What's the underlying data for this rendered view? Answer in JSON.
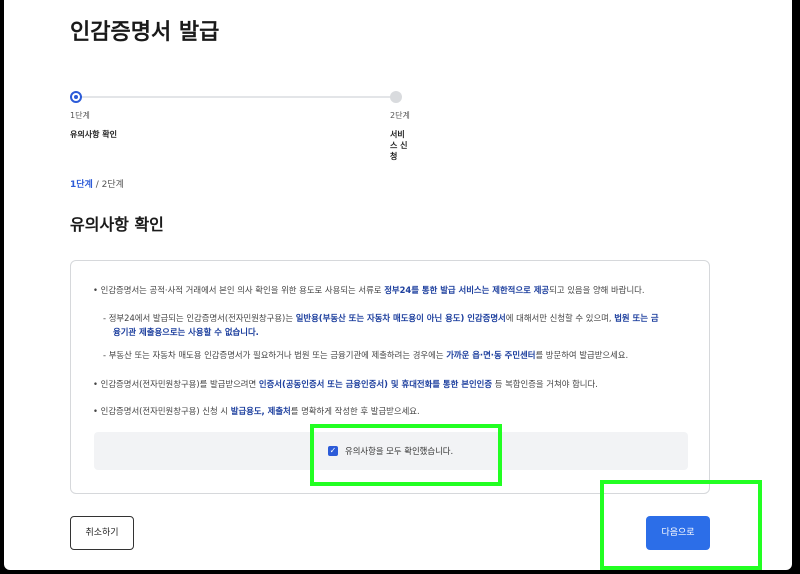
{
  "page": {
    "title": "인감증명서 발급"
  },
  "stepper": {
    "steps": [
      {
        "num": "1단계",
        "name": "유의사항 확인",
        "state": "active"
      },
      {
        "num": "2단계",
        "name": "서비스 신청",
        "state": "inactive"
      }
    ]
  },
  "breadcrumb": {
    "current": "1단계",
    "separator": " / ",
    "total": "2단계"
  },
  "section": {
    "title": "유의사항 확인"
  },
  "notice": {
    "items": [
      {
        "bullet": "•",
        "before": "인감증명서는 공적·사적 거래에서 본인 의사 확인을 위한 용도로 사용되는 서류로 ",
        "highlight": "정부24를 통한 발급 서비스는 제한적으로 제공",
        "after": "되고 있음을 양해 바랍니다."
      },
      {
        "dash": "-",
        "before": "정부24에서 발급되는 인감증명서(전자민원창구용)는 ",
        "highlight1": "일반용(부동산 또는 자동차 매도용이 아닌 용도) 인감증명서",
        "middle": "에 대해서만 신청할 수 있으며, ",
        "highlight2": "법원 또는 금",
        "line2": "융기관 제출용으로는 사용할 수 없습니다."
      },
      {
        "dash": "-",
        "before": "부동산 또는 자동차 매도용 인감증명서가 필요하거나 법원 또는 금융기관에 제출하려는 경우에는 ",
        "highlight": "가까운 읍·면·동 주민센터",
        "after": "를 방문하여 발급받으세요."
      },
      {
        "bullet": "•",
        "before": "인감증명서(전자민원창구용)를 발급받으려면 ",
        "highlight": "인증서(공동인증서 또는 금융인증서) 및 휴대전화를 통한 본인인증",
        "after": " 등 복합인증을 거쳐야 합니다."
      },
      {
        "bullet": "•",
        "before": "인감증명서(전자민원창구용) 신청 시 ",
        "highlight": "발급용도, 제출처",
        "after": "를 명확하게 작성한 후 발급받으세요."
      }
    ]
  },
  "confirm": {
    "label": "유의사항을 모두 확인했습니다.",
    "checked": true
  },
  "buttons": {
    "cancel": "취소하기",
    "next": "다음으로"
  },
  "colors": {
    "accent": "#2c5bd8",
    "primary_button": "#2c6ee8",
    "highlight_text": "#1d3f9e",
    "annotation": "#22ff22"
  }
}
